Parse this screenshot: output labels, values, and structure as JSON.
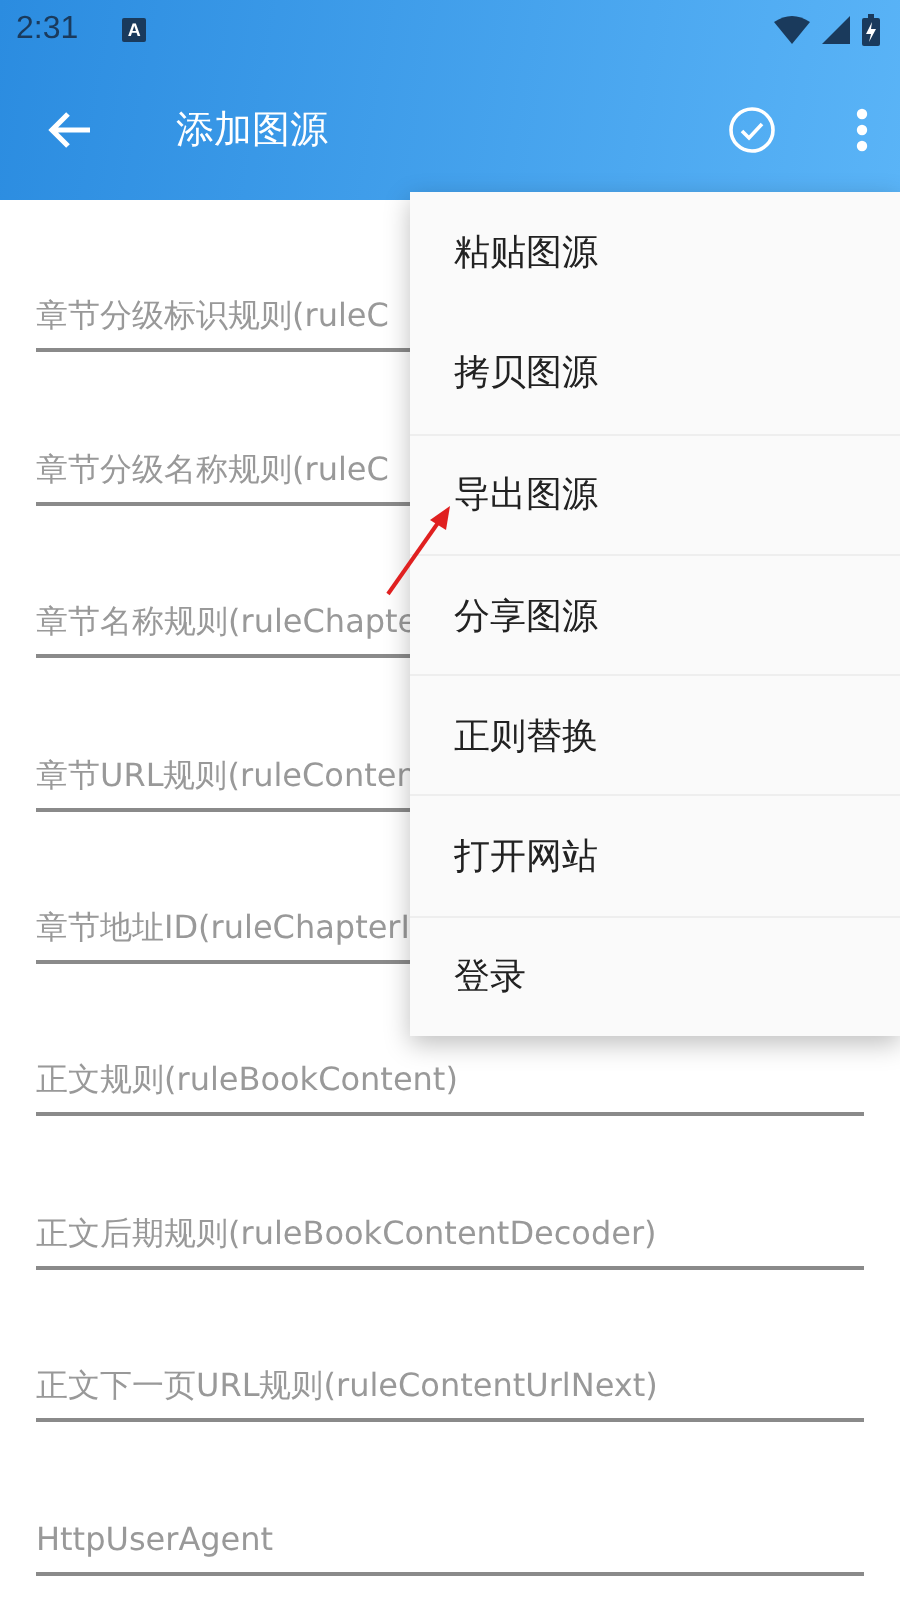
{
  "status_bar": {
    "time": "2:31",
    "notification": "A"
  },
  "toolbar": {
    "title": "添加图源"
  },
  "fields": [
    {
      "placeholder": "章节分级标识规则(ruleC"
    },
    {
      "placeholder": "章节分级名称规则(ruleC"
    },
    {
      "placeholder": "章节名称规则(ruleChapte"
    },
    {
      "placeholder": "章节URL规则(ruleConten"
    },
    {
      "placeholder": "章节地址ID(ruleChapterI"
    },
    {
      "placeholder": "正文规则(ruleBookContent)"
    },
    {
      "placeholder": "正文后期规则(ruleBookContentDecoder)"
    },
    {
      "placeholder": "正文下一页URL规则(ruleContentUrlNext)"
    },
    {
      "placeholder": "HttpUserAgent"
    }
  ],
  "menu": {
    "items": [
      {
        "label": "粘贴图源"
      },
      {
        "label": "拷贝图源"
      },
      {
        "label": "导出图源"
      },
      {
        "label": "分享图源"
      },
      {
        "label": "正则替换"
      },
      {
        "label": "打开网站"
      },
      {
        "label": "登录"
      }
    ]
  }
}
